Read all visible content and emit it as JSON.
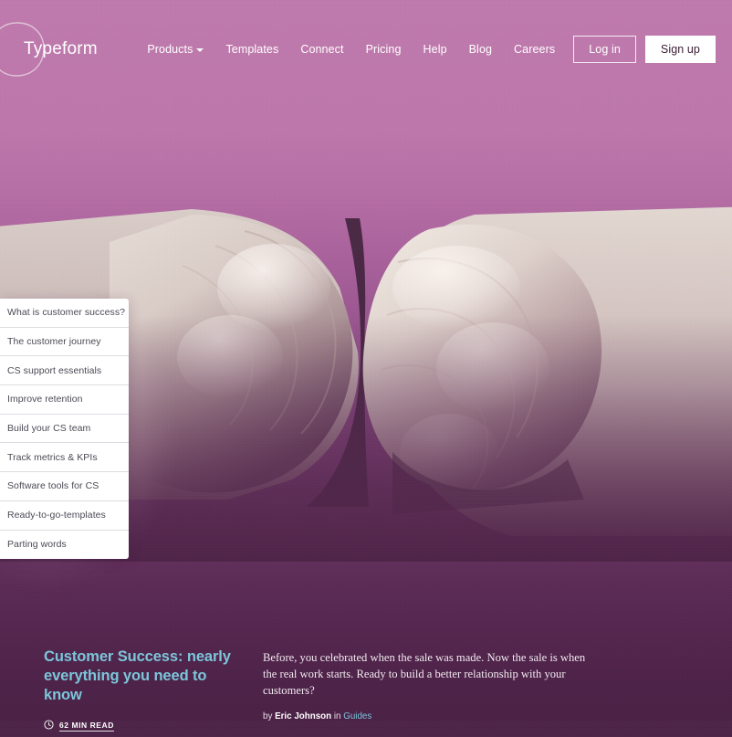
{
  "brand": {
    "name": "Typeform",
    "logo_icon": "circle-outline-icon"
  },
  "nav": {
    "items": [
      {
        "label": "Products",
        "has_caret": true
      },
      {
        "label": "Templates",
        "has_caret": false
      },
      {
        "label": "Connect",
        "has_caret": false
      },
      {
        "label": "Pricing",
        "has_caret": false
      },
      {
        "label": "Help",
        "has_caret": false
      },
      {
        "label": "Blog",
        "has_caret": false
      },
      {
        "label": "Careers",
        "has_caret": false
      }
    ],
    "login_label": "Log in",
    "signup_label": "Sign up"
  },
  "sidebar": {
    "items": [
      {
        "label": "What is customer success?"
      },
      {
        "label": "The customer journey"
      },
      {
        "label": "CS support essentials"
      },
      {
        "label": "Improve retention"
      },
      {
        "label": "Build your CS team"
      },
      {
        "label": "Track metrics & KPIs"
      },
      {
        "label": "Software tools for CS"
      },
      {
        "label": "Ready-to-go-templates"
      },
      {
        "label": "Parting words"
      }
    ]
  },
  "article": {
    "title": "Customer Success: nearly everything you need to know",
    "read_time": "62 MIN READ",
    "clock_icon": "clock-icon",
    "excerpt": "Before, you celebrated when the sale was made. Now the sale is when the real work starts. Ready to build a better relationship with your customers?",
    "byline_prefix": "by ",
    "author": "Eric Johnson",
    "byline_in": " in ",
    "category": "Guides"
  },
  "hero": {
    "image_alt": "two fists bumping",
    "image_icon": "fist-bump-photo"
  },
  "colors": {
    "bg_top": "#bf7aad",
    "bg_bottom": "#4a2145",
    "accent": "#7cc6da",
    "card": "#ffffff",
    "text_light": "#ffffff"
  }
}
